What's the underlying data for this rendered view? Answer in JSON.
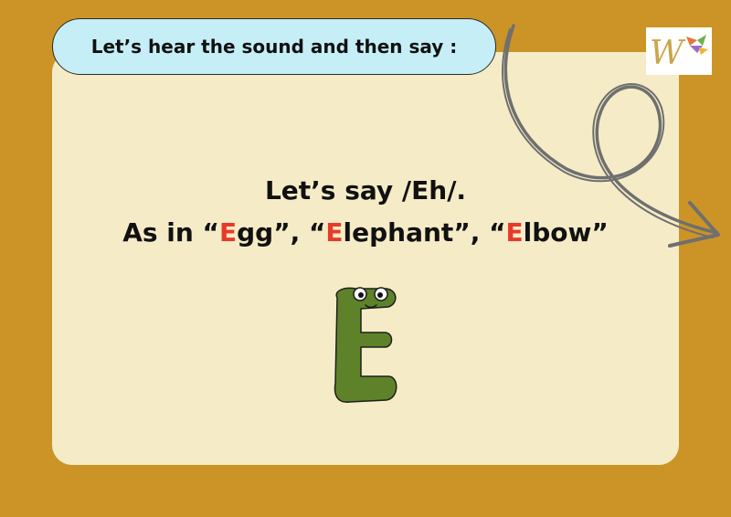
{
  "header": {
    "instruction": "Let’s hear the sound and then say :"
  },
  "logo": {
    "letter": "W"
  },
  "lesson": {
    "line1": "Let’s say /Eh/.",
    "line2_prefix": "As in “",
    "word1_initial": "E",
    "word1_rest": "gg",
    "sep1": "”, “",
    "word2_initial": "E",
    "word2_rest": "lephant",
    "sep2": "”, “",
    "word3_initial": "E",
    "word3_rest": "lbow",
    "line2_suffix": "”"
  },
  "colors": {
    "background": "#cc9426",
    "card": "#f5ecc7",
    "pill": "#c6eef7",
    "highlight": "#e8392b",
    "letter_green": "#5d8229"
  },
  "icons": {
    "arrow": "curly-arrow-icon",
    "mascot": "letter-e-character-icon",
    "logo": "w-logo-icon"
  }
}
